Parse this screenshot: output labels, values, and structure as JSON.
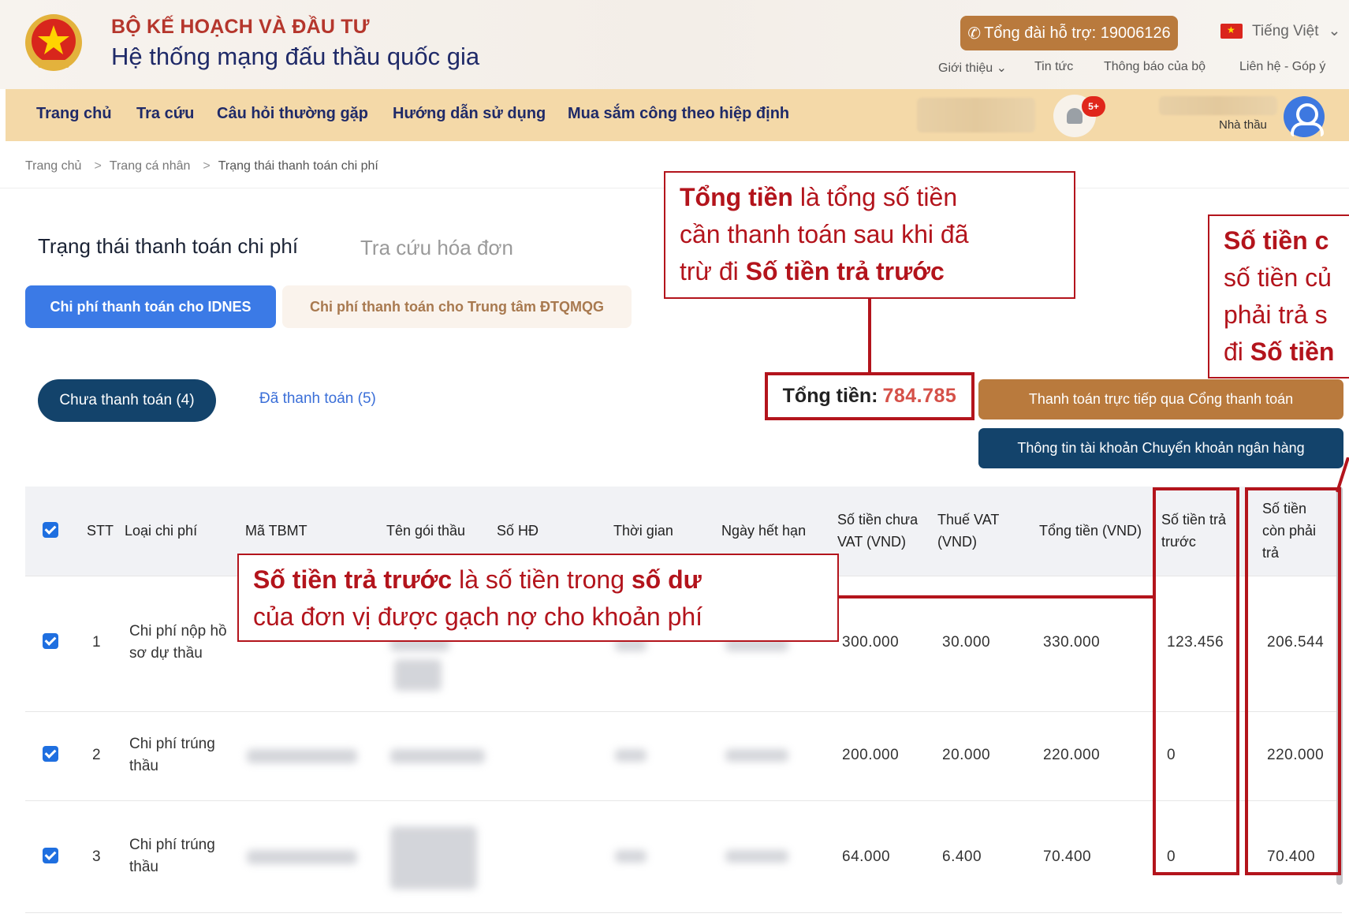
{
  "header": {
    "org_name": "BỘ KẾ HOẠCH VÀ ĐẦU TƯ",
    "system_name": "Hệ thống mạng đấu thầu quốc gia",
    "hotline": "Tổng đài hỗ trợ: 19006126",
    "language": "Tiếng Việt",
    "top_links": [
      "Giới thiệu",
      "Tin tức",
      "Thông báo của bộ",
      "Liên hệ - Góp ý"
    ]
  },
  "nav": {
    "items": [
      "Trang chủ",
      "Tra cứu",
      "Câu hỏi thường gặp",
      "Hướng dẫn sử dụng",
      "Mua sắm công theo hiệp định"
    ],
    "notification_badge": "5+",
    "user_role": "Nhà thầu"
  },
  "breadcrumb": [
    "Trang chủ",
    "Trang cá nhân",
    "Trạng thái thanh toán chi phí"
  ],
  "page": {
    "tab_active": "Trạng thái thanh toán chi phí",
    "tab_inactive": "Tra cứu hóa đơn",
    "cost_tab_idnes": "Chi phí thanh toán cho IDNES",
    "cost_tab_dtqmqg": "Chi phí thanh toán cho Trung tâm ĐTQMQG",
    "status_unpaid": "Chưa thanh toán (4)",
    "status_paid": "Đã thanh toán (5)",
    "total_label": "Tổng tiền:",
    "total_value": "784.785",
    "btn_gateway": "Thanh toán trực tiếp qua Cổng thanh toán",
    "btn_bank": "Thông tin tài khoản Chuyển khoản ngân hàng"
  },
  "table": {
    "headers": {
      "stt": "STT",
      "type": "Loại chi phí",
      "tbmt": "Mã TBMT",
      "package": "Tên gói thầu",
      "contract": "Số HĐ",
      "time": "Thời gian",
      "expiry": "Ngày hết hạn",
      "pre_vat_1": "Số tiền chưa",
      "pre_vat_2": "VAT (VND)",
      "vat_1": "Thuế VAT",
      "vat_2": "(VND)",
      "total": "Tổng tiền (VND)",
      "prepaid_1": "Số tiền trả",
      "prepaid_2": "trước",
      "remaining_1": "Số tiền",
      "remaining_2": "còn phải",
      "remaining_3": "trả"
    },
    "rows": [
      {
        "stt": "1",
        "type_1": "Chi phí nộp hồ",
        "type_2": "sơ dự thầu",
        "pre_vat": "300.000",
        "vat": "30.000",
        "total": "330.000",
        "prepaid": "123.456",
        "remaining": "206.544"
      },
      {
        "stt": "2",
        "type_1": "Chi phí trúng",
        "type_2": "thầu",
        "pre_vat": "200.000",
        "vat": "20.000",
        "total": "220.000",
        "prepaid": "0",
        "remaining": "220.000"
      },
      {
        "stt": "3",
        "type_1": "Chi phí trúng",
        "type_2": "thầu",
        "pre_vat": "64.000",
        "vat": "6.400",
        "total": "70.400",
        "prepaid": "0",
        "remaining": "70.400"
      }
    ]
  },
  "callouts": {
    "total": {
      "bold1": "Tổng tiền",
      "text1": " là tổng số tiền",
      "text2": "cần thanh toán sau khi đã",
      "text3": "trừ đi ",
      "bold2": "Số tiền trả trước"
    },
    "prepaid": {
      "bold1": "Số tiền trả trước",
      "text1": " là số tiền trong ",
      "bold2": "số dư",
      "text2": "của đơn vị được gạch nợ cho khoản phí"
    },
    "remaining": {
      "line1": "Số tiền c",
      "line2": "số tiền củ",
      "line3": "phải trả s",
      "line4": "đi ",
      "line4_bold": "Số tiền"
    }
  },
  "colors": {
    "accent_red": "#b3141c",
    "primary_blue": "#3b7ae6",
    "navy": "#13436b",
    "bronze": "#b97a3d",
    "nav_bg": "#f4d9a8"
  }
}
